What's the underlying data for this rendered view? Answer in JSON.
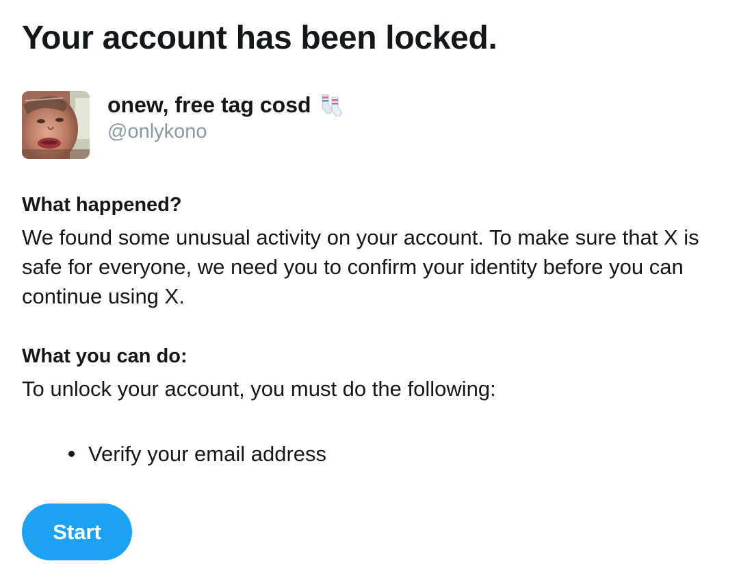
{
  "page": {
    "title": "Your account has been locked."
  },
  "account": {
    "display_name": "onew, free tag cosd",
    "name_emoji_icon": "socks-icon",
    "handle": "@onlykono"
  },
  "what_happened": {
    "heading": "What happened?",
    "body": "We found some unusual activity on your account. To make sure that X is safe for everyone, we need you to confirm your identity before you can continue using X."
  },
  "what_you_can_do": {
    "heading": "What you can do:",
    "body": "To unlock your account, you must do the following:",
    "steps": [
      "Verify your email address"
    ]
  },
  "actions": {
    "start_label": "Start"
  },
  "colors": {
    "accent": "#1da1f2",
    "text": "#14171a",
    "secondary_text": "#8899a6",
    "background": "#ffffff"
  }
}
